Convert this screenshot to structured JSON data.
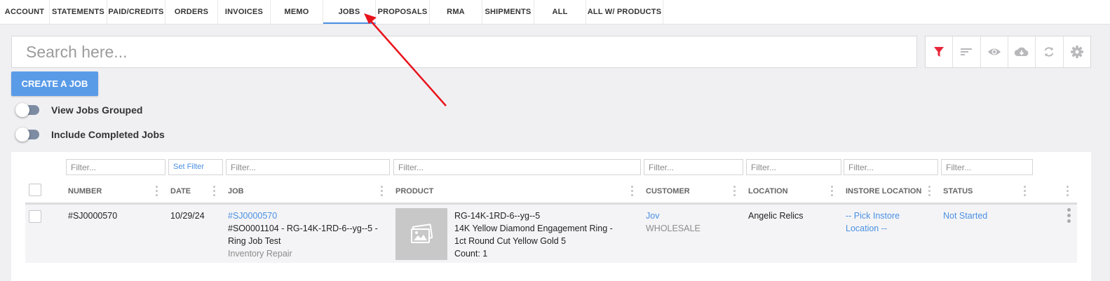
{
  "tabs": [
    "ACCOUNT",
    "STATEMENTS",
    "PAID/CREDITS",
    "ORDERS",
    "INVOICES",
    "MEMO",
    "JOBS",
    "PROPOSALS",
    "RMA",
    "SHIPMENTS",
    "ALL",
    "ALL W/ PRODUCTS"
  ],
  "active_tab": "JOBS",
  "search": {
    "placeholder": "Search here...",
    "value": ""
  },
  "toolbar": {
    "icons": [
      "filter-icon",
      "sort-icon",
      "eye-icon",
      "cloud-download-icon",
      "refresh-icon",
      "gear-icon"
    ],
    "active_color": "#e8253a",
    "icon_color": "#b8b8bc"
  },
  "create_button": "CREATE A JOB",
  "toggles": {
    "grouped": {
      "label": "View Jobs Grouped",
      "on": false
    },
    "completed": {
      "label": "Include Completed Jobs",
      "on": false
    }
  },
  "filters": {
    "placeholder": "Filter...",
    "set_filter": "Set Filter"
  },
  "columns": [
    "NUMBER",
    "DATE",
    "JOB",
    "PRODUCT",
    "CUSTOMER",
    "LOCATION",
    "INSTORE LOCATION",
    "STATUS"
  ],
  "rows": [
    {
      "number": "#SJ0000570",
      "date": "10/29/24",
      "job_link": "#SJ0000570",
      "job_line1": "#SO0001104 - RG-14K-1RD-6--yg--5 -",
      "job_line2": "Ring Job Test",
      "job_type": "Inventory Repair",
      "product_sku": "RG-14K-1RD-6--yg--5",
      "product_line1": "14K Yellow Diamond Engagement Ring -",
      "product_line2": "1ct Round Cut Yellow Gold 5",
      "product_count": "Count: 1",
      "customer": "Jov",
      "customer_type": "WHOLESALE",
      "location": "Angelic Relics",
      "instore_line1": "-- Pick Instore",
      "instore_line2": "Location --",
      "status": "Not Started"
    }
  ],
  "colors": {
    "accent": "#4a90e2",
    "button": "#5a9be8",
    "annotation_arrow": "#e8131b"
  }
}
